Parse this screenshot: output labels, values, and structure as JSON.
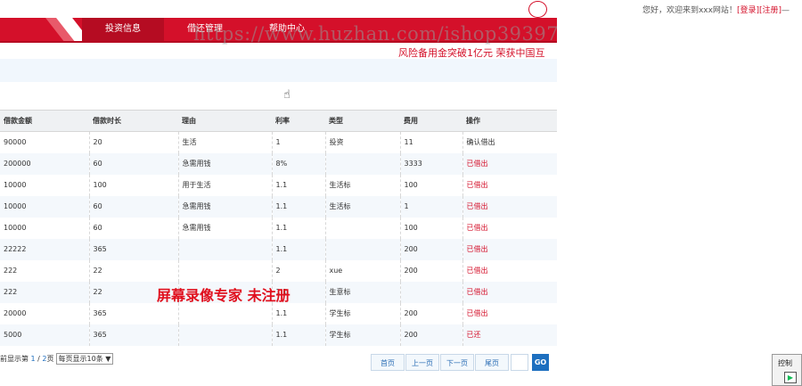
{
  "header": {
    "welcome_prefix": "您好，欢迎来到xxx网站！",
    "login": "[登录]",
    "register": "[注册]",
    "suffix": "—"
  },
  "nav": {
    "items": [
      {
        "label": "投资信息",
        "active": true
      },
      {
        "label": "借还管理",
        "active": false
      },
      {
        "label": "帮助中心",
        "active": false
      }
    ]
  },
  "slogan": "风险备用金突破1亿元  荣获中国互",
  "watermark_url": "https://www.huzhan.com/ishop39397",
  "cursor_icon": "hand-pointer-icon",
  "table": {
    "headers": [
      "借款金额",
      "借款时长",
      "理由",
      "利率",
      "类型",
      "费用",
      "操作"
    ],
    "rows": [
      [
        "90000",
        "20",
        "生活",
        "1",
        "投资",
        "11",
        "确认借出"
      ],
      [
        "200000",
        "60",
        "急需用钱",
        "8%",
        "",
        "3333",
        "已借出"
      ],
      [
        "10000",
        "100",
        "用于生活",
        "1.1",
        "生活标",
        "100",
        "已借出"
      ],
      [
        "10000",
        "60",
        "急需用钱",
        "1.1",
        "生活标",
        "1",
        "已借出"
      ],
      [
        "10000",
        "60",
        "急需用钱",
        "1.1",
        "",
        "100",
        "已借出"
      ],
      [
        "22222",
        "365",
        "",
        "1.1",
        "",
        "200",
        "已借出"
      ],
      [
        "222",
        "22",
        "",
        "2",
        "xue",
        "200",
        "已借出"
      ],
      [
        "222",
        "22",
        "",
        "1.1",
        "生意标",
        "",
        "已借出"
      ],
      [
        "20000",
        "365",
        "",
        "1.1",
        "学生标",
        "200",
        "已借出"
      ],
      [
        "5000",
        "365",
        "",
        "1.1",
        "学生标",
        "200",
        "已还"
      ]
    ]
  },
  "recorder_watermark": "屏幕录像专家  未注册",
  "pager": {
    "prefix": "前显示第 ",
    "current": "1",
    "sep": " / ",
    "total": "2",
    "suffix": "页",
    "per_page": "每页显示10条 ▼",
    "first": "首页",
    "prev": "上一页",
    "next": "下一页",
    "last": "尾页",
    "go": "GO"
  },
  "control": {
    "title": "控制",
    "play_icon": "play-icon",
    "play_glyph": "▶"
  },
  "colors": {
    "brand_red": "#d4102a",
    "link_blue": "#1f6fbf"
  }
}
